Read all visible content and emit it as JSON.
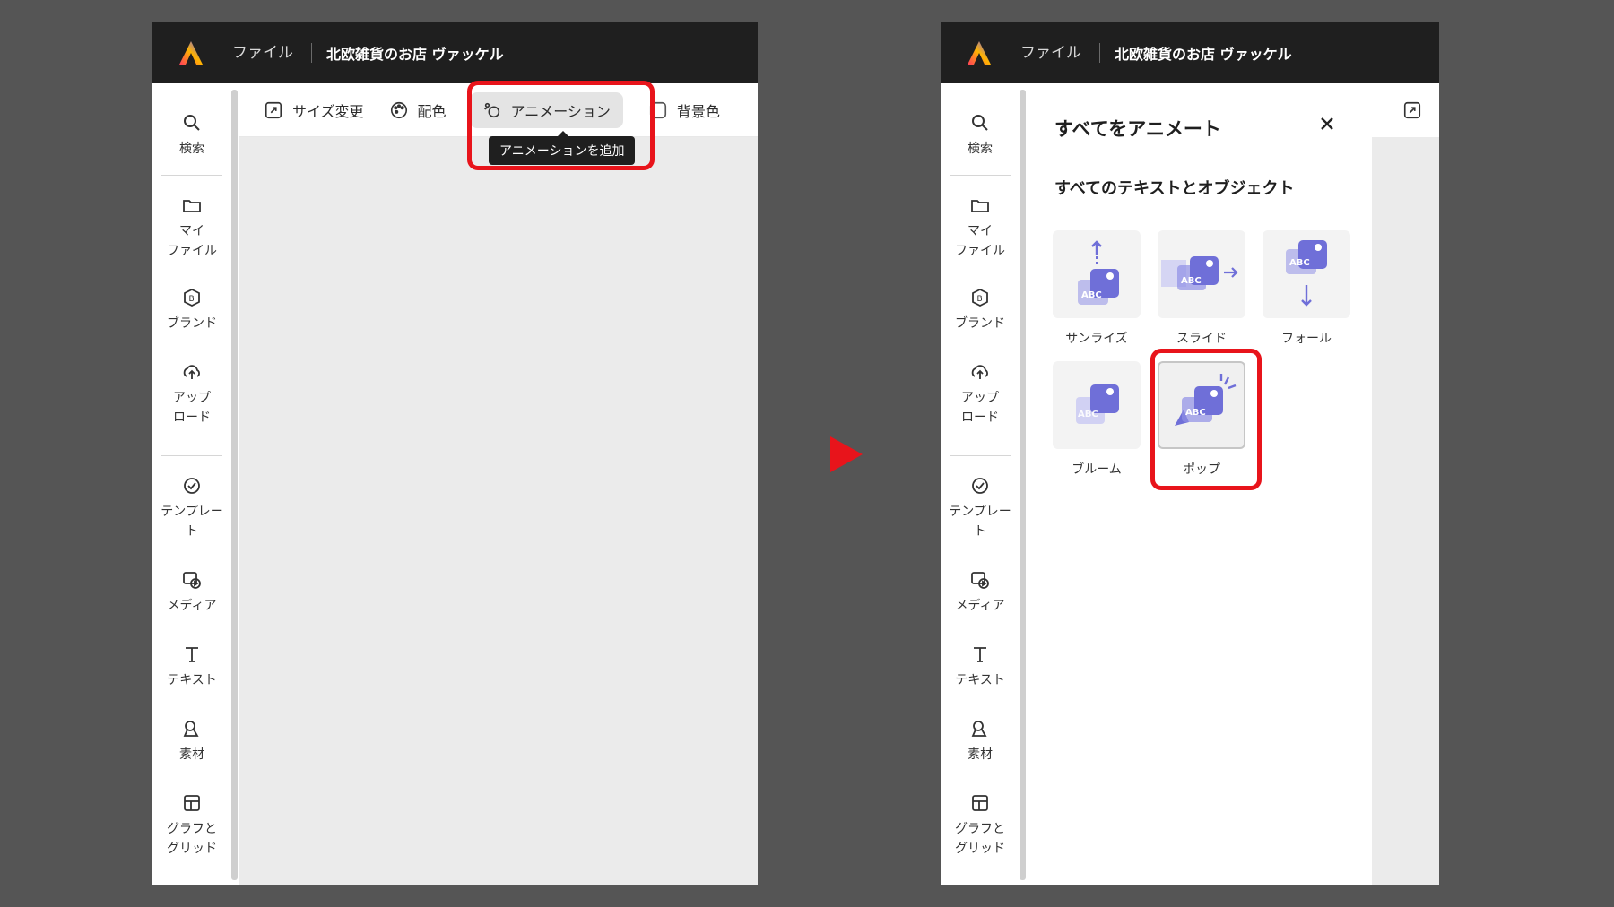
{
  "app": {
    "menu_file": "ファイル",
    "doc_title": "北欧雑貨のお店 ヴァッケル"
  },
  "sidebar": {
    "items": [
      {
        "label": "検索",
        "icon": "search-icon"
      },
      {
        "label": "マイ\nファイル",
        "icon": "folder-icon"
      },
      {
        "label": "ブランド",
        "icon": "brand-icon"
      },
      {
        "label": "アップ\nロード",
        "icon": "upload-icon"
      },
      {
        "label": "テンプレー\nト",
        "icon": "template-icon"
      },
      {
        "label": "メディア",
        "icon": "media-icon"
      },
      {
        "label": "テキスト",
        "icon": "text-icon"
      },
      {
        "label": "素材",
        "icon": "elements-icon"
      },
      {
        "label": "グラフと\nグリッド",
        "icon": "grid-icon"
      }
    ]
  },
  "toolbar": {
    "resize": "サイズ変更",
    "colors": "配色",
    "animation": "アニメーション",
    "background": "背景色",
    "tooltip": "アニメーションを追加"
  },
  "animate_panel": {
    "title": "すべてをアニメート",
    "subtitle": "すべてのテキストとオブジェクト",
    "options": [
      {
        "name": "サンライズ",
        "selected": false
      },
      {
        "name": "スライド",
        "selected": false
      },
      {
        "name": "フォール",
        "selected": false
      },
      {
        "name": "ブルーム",
        "selected": false
      },
      {
        "name": "ポップ",
        "selected": true
      }
    ]
  },
  "colors": {
    "highlight": "#e8141b",
    "accent": "#6f6fd8",
    "topbar": "#1f1f1f"
  }
}
